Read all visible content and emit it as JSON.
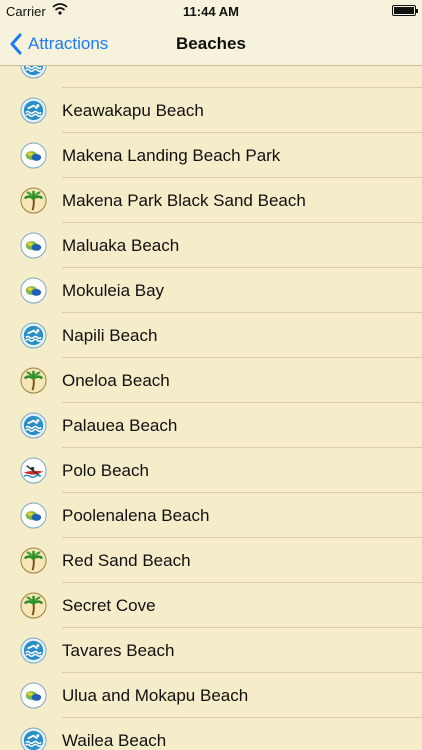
{
  "status": {
    "carrier": "Carrier",
    "time": "11:44 AM"
  },
  "nav": {
    "back_label": "Attractions",
    "title": "Beaches"
  },
  "colors": {
    "accent": "#1a7cf5",
    "background": "#f5ecca"
  },
  "beaches": [
    {
      "label": "",
      "icon": "swim-icon"
    },
    {
      "label": "Keawakapu Beach",
      "icon": "swim-icon"
    },
    {
      "label": "Makena Landing Beach Park",
      "icon": "snorkel-icon"
    },
    {
      "label": "Makena Park Black Sand Beach",
      "icon": "palm-tree-icon"
    },
    {
      "label": "Maluaka Beach",
      "icon": "snorkel-icon"
    },
    {
      "label": "Mokuleia Bay",
      "icon": "snorkel-icon"
    },
    {
      "label": "Napili Beach",
      "icon": "swim-icon"
    },
    {
      "label": "Oneloa Beach",
      "icon": "palm-tree-icon"
    },
    {
      "label": "Palauea Beach",
      "icon": "swim-icon"
    },
    {
      "label": "Polo Beach",
      "icon": "kayak-icon"
    },
    {
      "label": "Poolenalena Beach",
      "icon": "snorkel-icon"
    },
    {
      "label": "Red Sand Beach",
      "icon": "palm-tree-icon"
    },
    {
      "label": "Secret Cove",
      "icon": "palm-tree-icon"
    },
    {
      "label": "Tavares Beach",
      "icon": "swim-icon"
    },
    {
      "label": "Ulua and Mokapu Beach",
      "icon": "snorkel-icon"
    },
    {
      "label": "Wailea Beach",
      "icon": "swim-icon"
    }
  ]
}
